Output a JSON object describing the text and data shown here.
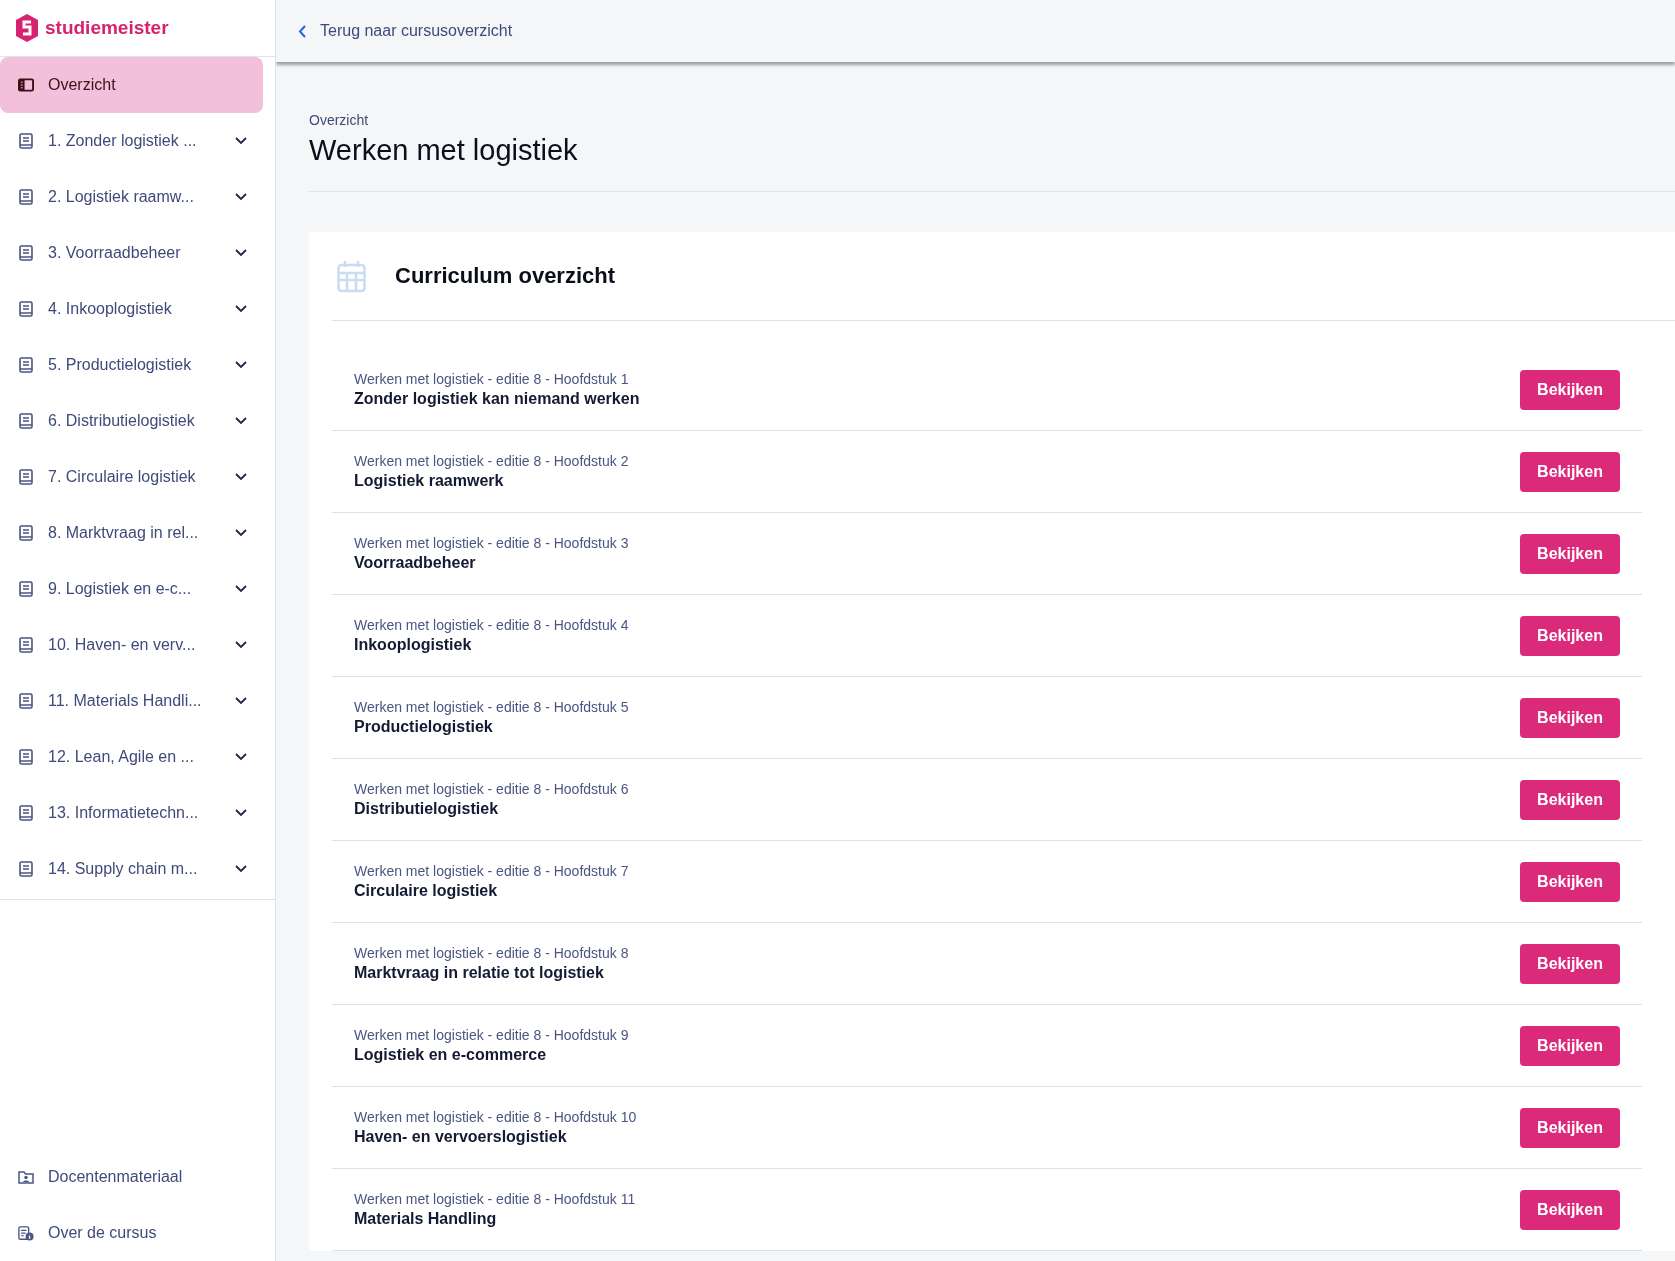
{
  "brand": {
    "name": "studiemeister"
  },
  "sidebar": {
    "items": [
      {
        "label": "Overzicht",
        "kind": "overview",
        "selected": true
      },
      {
        "label": "1. Zonder logistiek ...",
        "kind": "chapter",
        "selected": false
      },
      {
        "label": "2. Logistiek raamw...",
        "kind": "chapter",
        "selected": false
      },
      {
        "label": "3. Voorraadbeheer",
        "kind": "chapter",
        "selected": false
      },
      {
        "label": "4. Inkooplogistiek",
        "kind": "chapter",
        "selected": false
      },
      {
        "label": "5. Productielogistiek",
        "kind": "chapter",
        "selected": false
      },
      {
        "label": "6. Distributielogistiek",
        "kind": "chapter",
        "selected": false
      },
      {
        "label": "7. Circulaire logistiek",
        "kind": "chapter",
        "selected": false
      },
      {
        "label": "8. Marktvraag in rel...",
        "kind": "chapter",
        "selected": false
      },
      {
        "label": "9. Logistiek en e-c...",
        "kind": "chapter",
        "selected": false
      },
      {
        "label": "10. Haven- en verv...",
        "kind": "chapter",
        "selected": false
      },
      {
        "label": "11. Materials Handli...",
        "kind": "chapter",
        "selected": false
      },
      {
        "label": "12. Lean, Agile en ...",
        "kind": "chapter",
        "selected": false
      },
      {
        "label": "13. Informatietechn...",
        "kind": "chapter",
        "selected": false
      },
      {
        "label": "14. Supply chain m...",
        "kind": "chapter",
        "selected": false
      }
    ],
    "footer_items": [
      {
        "label": "Docentenmateriaal",
        "kind": "teacher"
      },
      {
        "label": "Over de cursus",
        "kind": "info"
      }
    ]
  },
  "top_bar": {
    "back_link": "Terug naar cursusoverzicht"
  },
  "page": {
    "breadcrumb": "Overzicht",
    "title": "Werken met logistiek"
  },
  "curriculum": {
    "title": "Curriculum overzicht",
    "rows": [
      {
        "subtitle": "Werken met logistiek - editie 8 - Hoofdstuk 1",
        "title": "Zonder logistiek kan niemand werken",
        "button": "Bekijken"
      },
      {
        "subtitle": "Werken met logistiek - editie 8 - Hoofdstuk 2",
        "title": "Logistiek raamwerk",
        "button": "Bekijken"
      },
      {
        "subtitle": "Werken met logistiek - editie 8 - Hoofdstuk 3",
        "title": "Voorraadbeheer",
        "button": "Bekijken"
      },
      {
        "subtitle": "Werken met logistiek - editie 8 - Hoofdstuk 4",
        "title": "Inkooplogistiek",
        "button": "Bekijken"
      },
      {
        "subtitle": "Werken met logistiek - editie 8 - Hoofdstuk 5",
        "title": "Productielogistiek",
        "button": "Bekijken"
      },
      {
        "subtitle": "Werken met logistiek - editie 8 - Hoofdstuk 6",
        "title": "Distributielogistiek",
        "button": "Bekijken"
      },
      {
        "subtitle": "Werken met logistiek - editie 8 - Hoofdstuk 7",
        "title": "Circulaire logistiek",
        "button": "Bekijken"
      },
      {
        "subtitle": "Werken met logistiek - editie 8 - Hoofdstuk 8",
        "title": "Marktvraag in relatie tot logistiek",
        "button": "Bekijken"
      },
      {
        "subtitle": "Werken met logistiek - editie 8 - Hoofdstuk 9",
        "title": "Logistiek en e-commerce",
        "button": "Bekijken"
      },
      {
        "subtitle": "Werken met logistiek - editie 8 - Hoofdstuk 10",
        "title": "Haven- en vervoerslogistiek",
        "button": "Bekijken"
      },
      {
        "subtitle": "Werken met logistiek - editie 8 - Hoofdstuk 11",
        "title": "Materials Handling",
        "button": "Bekijken"
      }
    ]
  }
}
